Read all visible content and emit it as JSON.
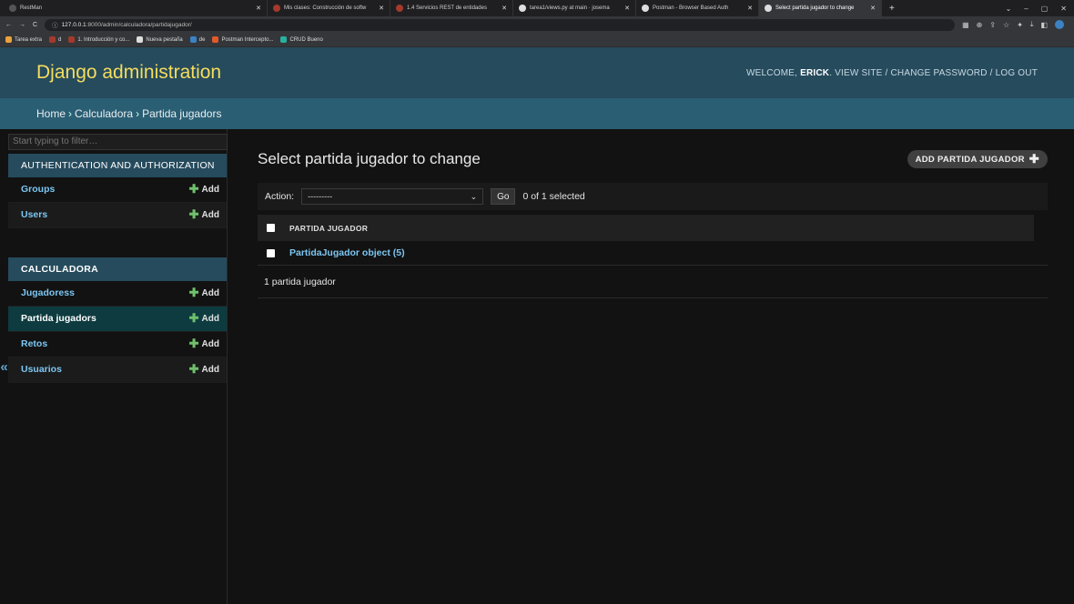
{
  "browser": {
    "tabs": [
      {
        "title": "RestMan",
        "color": "#555555"
      },
      {
        "title": "Mis clases: Construcción de softw",
        "color": "#a33a2a"
      },
      {
        "title": "1.4 Servicios REST de entidades",
        "color": "#a33a2a"
      },
      {
        "title": "tarea1/views.py at main · josema",
        "color": "#dddddd"
      },
      {
        "title": "Postman - Browser Based Auth",
        "color": "#dddddd"
      },
      {
        "title": "Select partida jugador to change",
        "color": "#dddddd",
        "active": true
      }
    ],
    "url_host": "127.0.0.1",
    "url_rest": ":8000/admin/calculadora/partidajugador/",
    "bookmarks": [
      {
        "label": "Tarea extra",
        "color": "#e8a33b"
      },
      {
        "label": "d",
        "color": "#a33a2a"
      },
      {
        "label": "1. Introducción y co...",
        "color": "#a33a2a"
      },
      {
        "label": "Nueva pestaña",
        "color": "#dddddd"
      },
      {
        "label": "de",
        "color": "#3b82c4"
      },
      {
        "label": "Postman Intercepto...",
        "color": "#e05a2b"
      },
      {
        "label": "CRUD Bueno",
        "color": "#2bb0a0"
      }
    ]
  },
  "header": {
    "brand": "Django administration",
    "welcome": "Welcome,",
    "username": "Erick",
    "view_site": "View site",
    "change_password": "Change password",
    "log_out": "Log out"
  },
  "breadcrumbs": {
    "home": "Home",
    "app": "Calculadora",
    "current": "Partida jugadors"
  },
  "sidebar": {
    "filter_placeholder": "Start typing to filter…",
    "add_label": "Add",
    "modules": [
      {
        "caption": "Authentication and Authorization",
        "items": [
          {
            "name": "Groups"
          },
          {
            "name": "Users"
          }
        ]
      },
      {
        "caption": "Calculadora",
        "items": [
          {
            "name": "Jugadoress"
          },
          {
            "name": "Partida jugadors",
            "current": true
          },
          {
            "name": "Retos"
          },
          {
            "name": "Usuarios"
          }
        ]
      }
    ],
    "toggle_label": "«"
  },
  "content": {
    "title": "Select partida jugador to change",
    "add_button": "Add partida jugador",
    "action_label": "Action:",
    "action_selected": "---------",
    "go_label": "Go",
    "selection_count": "0 of 1 selected",
    "column_header": "Partida jugador",
    "rows": [
      "PartidaJugador object (5)"
    ],
    "paginator": "1 partida jugador"
  }
}
